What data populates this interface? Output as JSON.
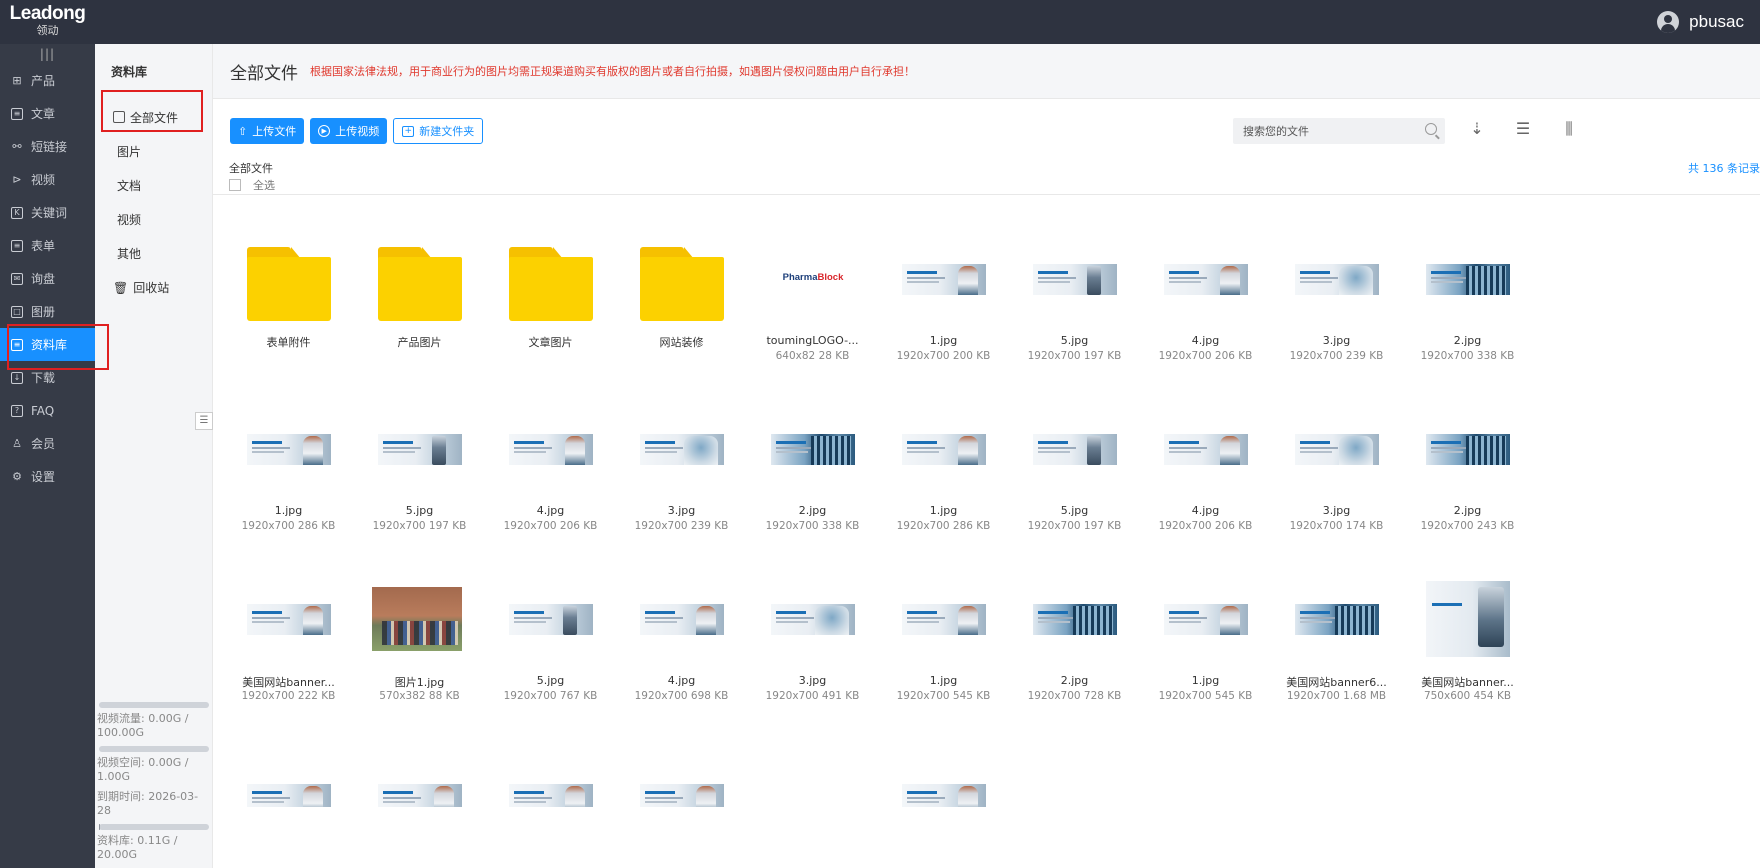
{
  "app": {
    "logo_en": "Leadong",
    "logo_cn": "领动",
    "username": "pbusac"
  },
  "leftnav": {
    "collapse_glyph": "|||",
    "items": [
      {
        "label": "产品",
        "icon": "product-grid-icon"
      },
      {
        "label": "文章",
        "icon": "article-icon"
      },
      {
        "label": "短链接",
        "icon": "short-link-icon"
      },
      {
        "label": "视频",
        "icon": "video-icon"
      },
      {
        "label": "关键词",
        "icon": "keyword-icon"
      },
      {
        "label": "表单",
        "icon": "form-icon"
      },
      {
        "label": "询盘",
        "icon": "inquiry-icon"
      },
      {
        "label": "图册",
        "icon": "album-icon"
      },
      {
        "label": "资料库",
        "icon": "library-icon",
        "active": true
      },
      {
        "label": "下载",
        "icon": "download-icon"
      },
      {
        "label": "FAQ",
        "icon": "faq-icon"
      },
      {
        "label": "会员",
        "icon": "member-icon"
      },
      {
        "label": "设置",
        "icon": "settings-icon"
      }
    ]
  },
  "subnav": {
    "title": "资料库",
    "items": [
      "全部文件",
      "图片",
      "文档",
      "视频",
      "其他",
      "回收站"
    ],
    "storage": {
      "video_traffic": "视频流量: 0.00G / 100.00G",
      "video_space": "视频空间: 0.00G / 1.00G",
      "expiry": "到期时间: 2026-03-28",
      "library": "资料库: 0.11G / 20.00G",
      "video_traffic_pct": 0,
      "video_space_pct": 0,
      "library_pct": 0.55
    }
  },
  "main": {
    "title": "全部文件",
    "notice": "根据国家法律法规，用于商业行为的图片均需正规渠道购买有版权的图片或者自行拍摄，如遇图片侵权问题由用户自行承担！",
    "buttons": {
      "upload_file": "上传文件",
      "upload_video": "上传视频",
      "new_folder": "新建文件夹"
    },
    "search_placeholder": "搜索您的文件",
    "breadcrumb": "全部文件",
    "select_all": "全选",
    "count": "共 136 条记录",
    "view_icons": [
      "sort-icon",
      "list-view-icon",
      "column-view-icon"
    ]
  },
  "files": [
    {
      "name": "表单附件",
      "meta": "",
      "kind": "folder"
    },
    {
      "name": "产品图片",
      "meta": "",
      "kind": "folder"
    },
    {
      "name": "文章图片",
      "meta": "",
      "kind": "folder"
    },
    {
      "name": "网站装修",
      "meta": "",
      "kind": "folder"
    },
    {
      "name": "toumingLOGO-...",
      "meta": "640x82  28 KB",
      "kind": "logo",
      "logo_a": "Pharma",
      "logo_b": "Block"
    },
    {
      "name": "1.jpg",
      "meta": "1920x700  200 KB",
      "kind": "banner"
    },
    {
      "name": "5.jpg",
      "meta": "1920x700  197 KB",
      "kind": "banner-clean"
    },
    {
      "name": "4.jpg",
      "meta": "1920x700  206 KB",
      "kind": "banner"
    },
    {
      "name": "3.jpg",
      "meta": "1920x700  239 KB",
      "kind": "banner-kilo"
    },
    {
      "name": "2.jpg",
      "meta": "1920x700  338 KB",
      "kind": "banner-dark"
    },
    {
      "name": "1.jpg",
      "meta": "1920x700  286 KB",
      "kind": "banner"
    },
    {
      "name": "5.jpg",
      "meta": "1920x700  197 KB",
      "kind": "banner-clean"
    },
    {
      "name": "4.jpg",
      "meta": "1920x700  206 KB",
      "kind": "banner"
    },
    {
      "name": "3.jpg",
      "meta": "1920x700  239 KB",
      "kind": "banner-kilo"
    },
    {
      "name": "2.jpg",
      "meta": "1920x700  338 KB",
      "kind": "banner-dark"
    },
    {
      "name": "1.jpg",
      "meta": "1920x700  286 KB",
      "kind": "banner"
    },
    {
      "name": "5.jpg",
      "meta": "1920x700  197 KB",
      "kind": "banner-clean"
    },
    {
      "name": "4.jpg",
      "meta": "1920x700  206 KB",
      "kind": "banner"
    },
    {
      "name": "3.jpg",
      "meta": "1920x700  174 KB",
      "kind": "banner-kilo"
    },
    {
      "name": "2.jpg",
      "meta": "1920x700  243 KB",
      "kind": "banner-dark"
    },
    {
      "name": "美国网站banner...",
      "meta": "1920x700  222 KB",
      "kind": "banner"
    },
    {
      "name": "图片1.jpg",
      "meta": "570x382  88 KB",
      "kind": "photo"
    },
    {
      "name": "5.jpg",
      "meta": "1920x700  767 KB",
      "kind": "banner-clean"
    },
    {
      "name": "4.jpg",
      "meta": "1920x700  698 KB",
      "kind": "banner"
    },
    {
      "name": "3.jpg",
      "meta": "1920x700  491 KB",
      "kind": "banner-kilo"
    },
    {
      "name": "1.jpg",
      "meta": "1920x700  545 KB",
      "kind": "banner"
    },
    {
      "name": "2.jpg",
      "meta": "1920x700  728 KB",
      "kind": "banner-dark"
    },
    {
      "name": "1.jpg",
      "meta": "1920x700  545 KB",
      "kind": "banner"
    },
    {
      "name": "美国网站banner6...",
      "meta": "1920x700  1.68 MB",
      "kind": "banner-dark"
    },
    {
      "name": "美国网站banner...",
      "meta": "750x600  454 KB",
      "kind": "tall"
    },
    {
      "name": "",
      "meta": "",
      "kind": "banner-partial"
    },
    {
      "name": "",
      "meta": "",
      "kind": "banner-partial"
    },
    {
      "name": "",
      "meta": "",
      "kind": "banner-partial"
    },
    {
      "name": "",
      "meta": "",
      "kind": "banner-partial"
    },
    {
      "name": "",
      "meta": "",
      "kind": "empty"
    },
    {
      "name": "",
      "meta": "",
      "kind": "banner-partial"
    }
  ],
  "colors": {
    "accent": "#1890ff",
    "topbar": "#2e3340",
    "nav": "#363b47",
    "notice": "#e0392e",
    "folder": "#fcd100",
    "highlight": "#e02020"
  }
}
